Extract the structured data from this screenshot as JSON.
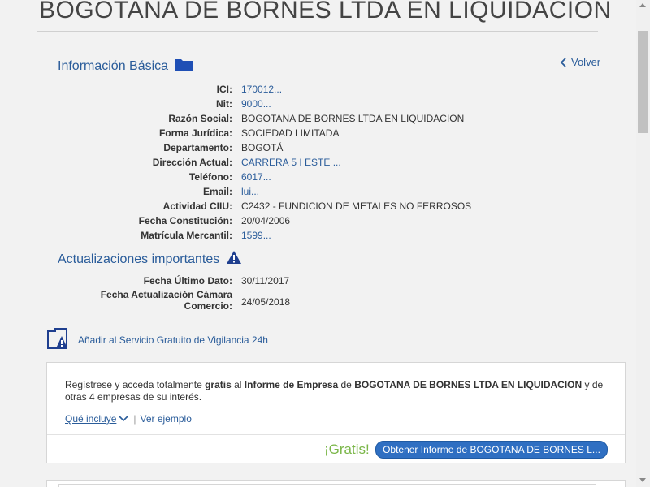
{
  "page": {
    "company_title": "BOGOTANA DE BORNES LTDA EN LIQUIDACION"
  },
  "basic_info": {
    "heading": "Información Básica",
    "heading_icon": "folder-icon",
    "back_label": "Volver",
    "rows": [
      {
        "label": "ICI:",
        "value": "170012..."
      },
      {
        "label": "Nit:",
        "value": "9000..."
      },
      {
        "label": "Razón Social:",
        "value": "BOGOTANA DE BORNES LTDA EN LIQUIDACION"
      },
      {
        "label": "Forma Jurídica:",
        "value": "SOCIEDAD LIMITADA"
      },
      {
        "label": "Departamento:",
        "value": "BOGOTÁ"
      },
      {
        "label": "Dirección Actual:",
        "value": "CARRERA 5 I ESTE ..."
      },
      {
        "label": "Teléfono:",
        "value": "6017..."
      },
      {
        "label": "Email:",
        "value": "lui..."
      },
      {
        "label": "Actividad CIIU:",
        "value": "C2432 - FUNDICION DE METALES NO FERROSOS"
      },
      {
        "label": "Fecha Constitución:",
        "value": "20/04/2006"
      },
      {
        "label": "Matrícula Mercantil:",
        "value": "1599..."
      }
    ]
  },
  "updates": {
    "heading": "Actualizaciones importantes",
    "heading_icon": "warning-icon",
    "rows": [
      {
        "label": "Fecha Último Dato:",
        "value": "30/11/2017"
      },
      {
        "label_line1": "Fecha Actualización Cámara",
        "label_line2": "Comercio:",
        "value": "24/05/2018"
      }
    ]
  },
  "vigilancia": {
    "label": "Añadir al Servicio Gratuito de Vigilancia 24h",
    "icon": "monitor-alert-icon"
  },
  "promo": {
    "text_part1": "Regístrese y acceda totalmente ",
    "text_bold1": "gratis",
    "text_part2": " al ",
    "text_bold2": "Informe de Empresa",
    "text_part3": " de ",
    "text_bold3": "BOGOTANA DE BORNES LTDA EN LIQUIDACION",
    "text_part4": " y de otras 4 empresas de su interés.",
    "que_incluye": "Qué incluye",
    "separator": "|",
    "ver_ejemplo": "Ver ejemplo",
    "gratis": "¡Gratis!",
    "cta_label": "Obtener Informe de BOGOTANA DE BORNES L..."
  },
  "colors": {
    "link": "#2a5c9a",
    "accent_green": "#7ab648",
    "button_blue": "#2f6fc2"
  }
}
